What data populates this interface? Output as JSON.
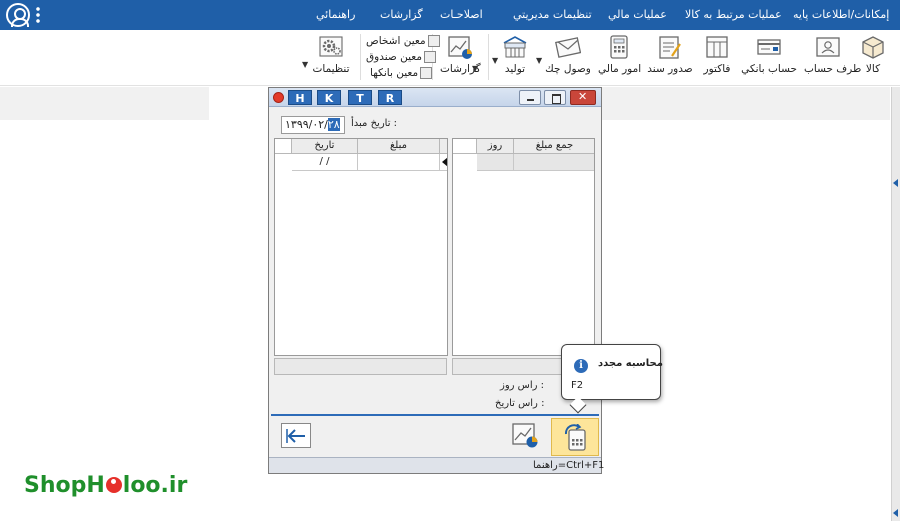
{
  "menubar": {
    "items": [
      "إمكانات/اطلاعات پايه",
      "عمليات مرتبط به کالا",
      "عمليات مالي",
      "تنظيمات مديريتي",
      "اصلاحـات",
      "گزارشات",
      "راهنمائي"
    ]
  },
  "ribbon": {
    "buttons": [
      "کالا",
      "طرف حساب",
      "حساب بانکي",
      "فاکتور",
      "صدور سند",
      "امور مالي",
      "وصول چك",
      "توليد",
      "گزارشات",
      "تنظيمات"
    ],
    "small_items": [
      "معين اشخاص",
      "معين صندوق",
      "معين بانکها"
    ]
  },
  "dialog": {
    "hk_buttons": [
      "H",
      "K",
      "T",
      "R"
    ],
    "date_label": "تاريخ مبدأ :",
    "date_value_pre": "۱۳۹۹/۰۲/",
    "date_value_sel": "۲۸",
    "grid_left": {
      "headers": [
        "تاريخ",
        "مبلغ"
      ],
      "row": [
        "/ /",
        ""
      ]
    },
    "grid_right": {
      "headers": [
        "روز",
        "جمع مبلغ"
      ]
    },
    "labels": [
      "راس روز :",
      "راس تاريخ :"
    ],
    "status": "راهنما=Ctrl+F1"
  },
  "tooltip": {
    "title": "محاسبه مجدد",
    "shortcut": "F2"
  },
  "logo": {
    "text": "ShopHoloo.ir",
    "part1": "ShopH",
    "part2": "loo.ir"
  },
  "colors": {
    "accent": "#1f5fa8",
    "logo": "#1f8f2b",
    "logo_dot": "#e6302a",
    "highlight": "#fde59a"
  }
}
